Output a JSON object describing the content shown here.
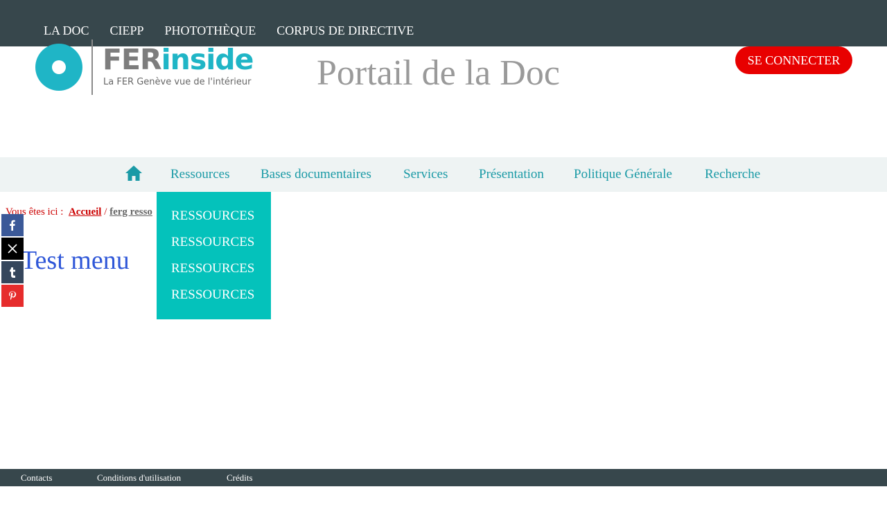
{
  "top_nav": [
    "LA DOC",
    "CIEPP",
    "PHOTOTHÈQUE",
    "CORPUS DE DIRECTIVE"
  ],
  "logo": {
    "brand_fer": "FER",
    "brand_inside": "inside",
    "tagline": "La FER Genève vue de l'intérieur"
  },
  "portal_title": "Portail de la Doc",
  "login_button": "SE CONNECTER",
  "main_nav": {
    "home_icon": "home-icon",
    "items": [
      "Ressources",
      "Bases documentaires",
      "Services",
      "Présentation",
      "Politique Générale",
      "Recherche"
    ]
  },
  "dropdown": [
    "RESSOURCES",
    "RESSOURCES",
    "RESSOURCES",
    "RESSOURCES"
  ],
  "breadcrumb": {
    "prefix": "Vous êtes ici :",
    "home": "Accueil",
    "sep": "/",
    "current": "ferg resso"
  },
  "page_title": "Test menu",
  "social": [
    {
      "name": "facebook-icon",
      "color": "#3b5998"
    },
    {
      "name": "x-icon",
      "color": "#000000"
    },
    {
      "name": "tumblr-icon",
      "color": "#35465c"
    },
    {
      "name": "pinterest-icon",
      "color": "#e62c2c"
    }
  ],
  "footer": [
    "Contacts",
    "Conditions d'utilisation",
    "Crédits"
  ],
  "colors": {
    "topbar": "#37474c",
    "accent": "#1a9aa6",
    "dropdown": "#04c2bb",
    "login": "#e80000"
  }
}
